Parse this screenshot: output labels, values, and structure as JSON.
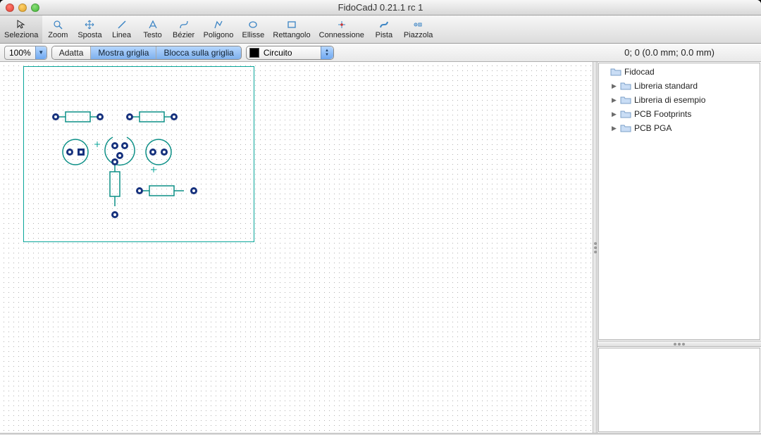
{
  "window": {
    "title": "FidoCadJ 0.21.1 rc 1"
  },
  "toolbar": {
    "items": [
      {
        "label": "Seleziona",
        "icon": "cursor"
      },
      {
        "label": "Zoom",
        "icon": "zoom"
      },
      {
        "label": "Sposta",
        "icon": "move"
      },
      {
        "label": "Linea",
        "icon": "line"
      },
      {
        "label": "Testo",
        "icon": "text"
      },
      {
        "label": "Bézier",
        "icon": "bezier"
      },
      {
        "label": "Poligono",
        "icon": "polygon"
      },
      {
        "label": "Ellisse",
        "icon": "ellipse"
      },
      {
        "label": "Rettangolo",
        "icon": "rect"
      },
      {
        "label": "Connessione",
        "icon": "conn"
      },
      {
        "label": "Pista",
        "icon": "track"
      },
      {
        "label": "Piazzola",
        "icon": "pad"
      }
    ],
    "selectedIndex": 0
  },
  "zoom": {
    "value": "100%"
  },
  "segments": {
    "adatta": "Adatta",
    "mostra": "Mostra griglia",
    "blocca": "Blocca sulla griglia"
  },
  "layer": {
    "name": "Circuito",
    "color": "#000000"
  },
  "status_text": "0; 0 (0.0 mm; 0.0 mm)",
  "tree": {
    "root": "Fidocad",
    "children": [
      "Libreria standard",
      "Libreria di esempio",
      "PCB Footprints",
      "PCB PGA"
    ]
  }
}
